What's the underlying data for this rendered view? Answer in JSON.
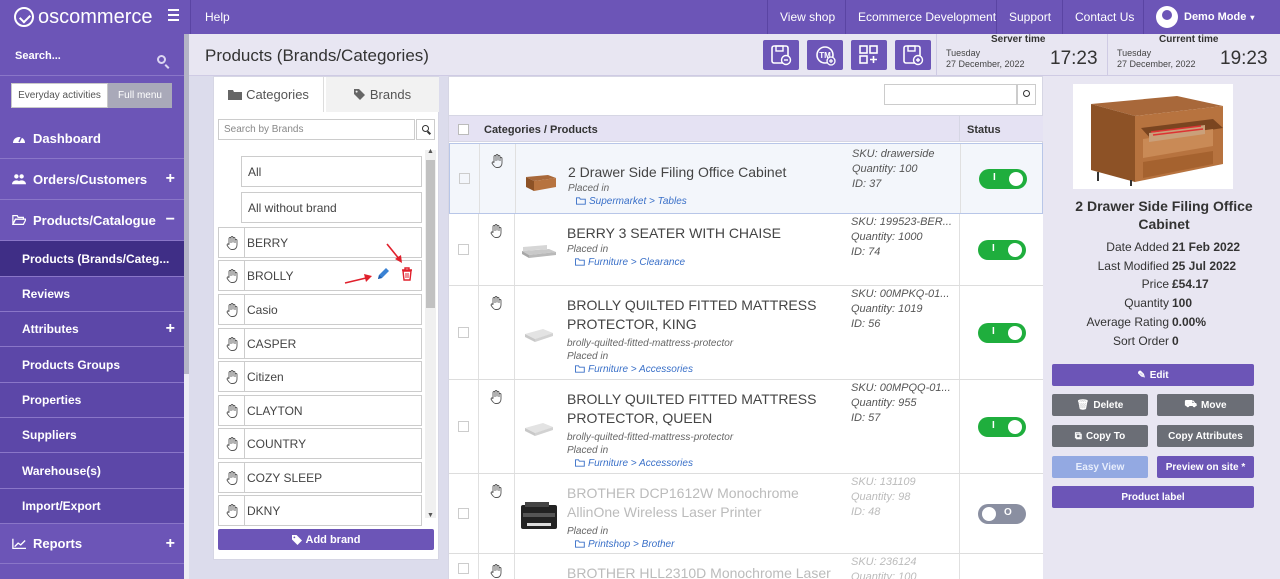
{
  "brand": {
    "logo_text": "oscommerce"
  },
  "topnav": {
    "help": "Help",
    "view_shop": "View shop",
    "ecommerce_dev": "Ecommerce Development",
    "support": "Support",
    "contact_us": "Contact Us",
    "demo_mode": "Demo Mode"
  },
  "sidebar": {
    "search_label": "Search...",
    "seg_everyday": "Everyday activities",
    "seg_full": "Full menu",
    "items": [
      {
        "label": "Dashboard",
        "icon": "dashboard-icon"
      },
      {
        "label": "Orders/Customers",
        "icon": "users-icon",
        "expand": "+"
      },
      {
        "label": "Products/Catalogue",
        "icon": "folder-open-icon",
        "expand": "−"
      },
      {
        "label": "Products (Brands/Categ...",
        "sub": true,
        "active": true
      },
      {
        "label": "Reviews",
        "sub": true
      },
      {
        "label": "Attributes",
        "sub": true,
        "expand": "+"
      },
      {
        "label": "Products Groups",
        "sub": true
      },
      {
        "label": "Properties",
        "sub": true
      },
      {
        "label": "Suppliers",
        "sub": true
      },
      {
        "label": "Warehouse(s)",
        "sub": true
      },
      {
        "label": "Import/Export",
        "sub": true
      },
      {
        "label": "Reports",
        "icon": "chart-line-icon",
        "expand": "+"
      }
    ]
  },
  "header": {
    "title": "Products (Brands/Categories)",
    "server_time_label": "Server time",
    "server_day": "Tuesday",
    "server_date": "27 December, 2022",
    "server_clock": "17:23",
    "current_time_label": "Current time",
    "current_day": "Tuesday",
    "current_date": "27 December, 2022",
    "current_clock": "19:23"
  },
  "left_panel": {
    "tab_categories": "Categories",
    "tab_brands": "Brands",
    "search_placeholder": "Search by Brands",
    "all": "All",
    "all_without_brand": "All without brand",
    "brands": [
      "BERRY",
      "BROLLY",
      "Casio",
      "CASPER",
      "Citizen",
      "CLAYTON",
      "COUNTRY",
      "COZY SLEEP",
      "DKNY"
    ],
    "add_brand": "Add brand"
  },
  "table": {
    "col_products": "Categories / Products",
    "col_status": "Status",
    "placed_in": "Placed in",
    "rows": [
      {
        "name": "2 Drawer Side Filing Office Cabinet",
        "slug": "",
        "path_a": "Supermarket",
        "path_b": "Tables",
        "sku": "SKU: drawerside",
        "qty": "Quantity: 100",
        "id": "ID: 37",
        "status": "on"
      },
      {
        "name": "BERRY 3 SEATER WITH CHAISE",
        "slug": "",
        "path_a": "Furniture",
        "path_b": "Clearance",
        "sku": "SKU: 199523-BER...",
        "qty": "Quantity: 1000",
        "id": "ID: 74",
        "status": "on"
      },
      {
        "name": "BROLLY QUILTED FITTED MATTRESS PROTECTOR, KING",
        "slug": "brolly-quilted-fitted-mattress-protector",
        "path_a": "Furniture",
        "path_b": "Accessories",
        "sku": "SKU: 00MPKQ-01...",
        "qty": "Quantity: 1019",
        "id": "ID: 56",
        "status": "on"
      },
      {
        "name": "BROLLY QUILTED FITTED MATTRESS PROTECTOR, QUEEN",
        "slug": "brolly-quilted-fitted-mattress-protector",
        "path_a": "Furniture",
        "path_b": "Accessories",
        "sku": "SKU: 00MPQQ-01...",
        "qty": "Quantity: 955",
        "id": "ID: 57",
        "status": "on"
      },
      {
        "name": "BROTHER DCP1612W Monochrome AllinOne Wireless Laser Printer",
        "slug": "",
        "path_a": "Printshop",
        "path_b": "Brother",
        "sku": "SKU: 131109",
        "qty": "Quantity: 98",
        "id": "ID: 48",
        "status": "off"
      },
      {
        "name": "BROTHER HLL2310D Monochrome Laser",
        "slug": "",
        "path_a": "",
        "path_b": "",
        "sku": "SKU: 236124",
        "qty": "Quantity: 100",
        "id": "",
        "status": ""
      }
    ],
    "toggle_on_text": "I",
    "toggle_off_text": "O"
  },
  "right_panel": {
    "product_name": "2 Drawer Side Filing Office Cabinet",
    "date_added_k": "Date Added",
    "date_added_v": "21 Feb 2022",
    "last_modified_k": "Last Modified",
    "last_modified_v": "25 Jul 2022",
    "price_k": "Price",
    "price_v": "£54.17",
    "quantity_k": "Quantity",
    "quantity_v": "100",
    "rating_k": "Average Rating",
    "rating_v": "0.00%",
    "sort_k": "Sort Order",
    "sort_v": "0",
    "edit": "Edit",
    "delete": "Delete",
    "move": "Move",
    "copy_to": "Copy To",
    "copy_attributes": "Copy Attributes",
    "easy_view": "Easy View",
    "preview": "Preview on site *",
    "product_label": "Product label"
  },
  "colors": {
    "brand": "#6c55b7",
    "toggle_on": "#1fae3d",
    "annotation_red": "#e0202c",
    "link": "#3a70c8"
  }
}
